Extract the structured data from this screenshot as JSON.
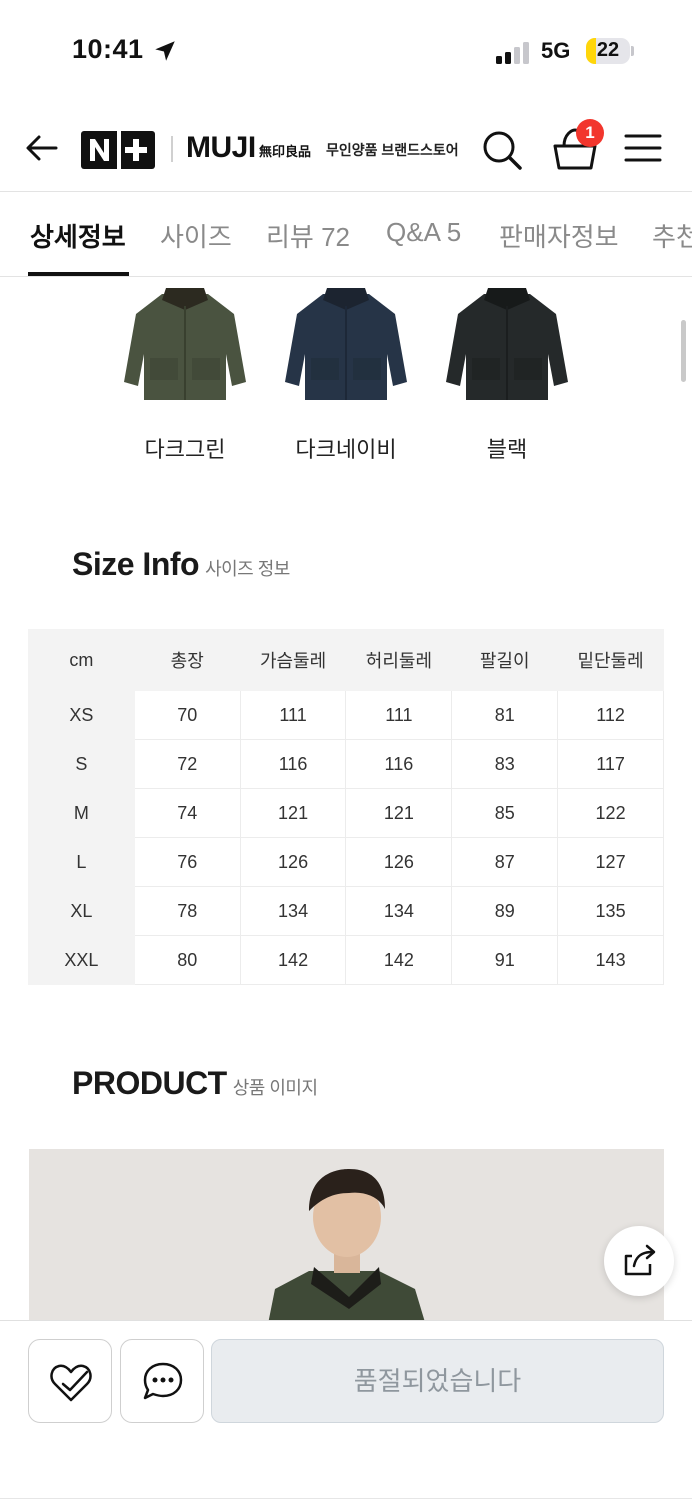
{
  "status_bar": {
    "time": "10:41",
    "network": "5G",
    "battery_level": "22",
    "battery_fraction": 0.22,
    "location_icon": "location-arrow-icon",
    "signal_icon": "cellular-signal-icon"
  },
  "header": {
    "logo_mark": "N+",
    "brand": "MUJI",
    "brand_kanji": "無印良品",
    "store_name": "무인양품 브랜드스토어",
    "cart_count": "1",
    "icons": [
      "back-arrow-icon",
      "search-icon",
      "shopping-bag-icon",
      "hamburger-menu-icon"
    ]
  },
  "tabs": [
    {
      "label": "상세정보",
      "active": true
    },
    {
      "label": "사이즈",
      "active": false
    },
    {
      "label": "리뷰 72",
      "active": false
    },
    {
      "label": "Q&A 5",
      "active": false
    },
    {
      "label": "판매자정보",
      "active": false
    },
    {
      "label": "추천",
      "active": false
    }
  ],
  "colors": [
    {
      "name": "다크그린",
      "swatch": "#4a5340"
    },
    {
      "name": "다크네이비",
      "swatch": "#263447"
    },
    {
      "name": "블랙",
      "swatch": "#25292a"
    }
  ],
  "size_info": {
    "title": "Size Info",
    "subtitle": "사이즈 정보",
    "headers": [
      "cm",
      "총장",
      "가슴둘레",
      "허리둘레",
      "팔길이",
      "밑단둘레"
    ],
    "rows": [
      [
        "XS",
        "70",
        "111",
        "111",
        "81",
        "112"
      ],
      [
        "S",
        "72",
        "116",
        "116",
        "83",
        "117"
      ],
      [
        "M",
        "74",
        "121",
        "121",
        "85",
        "122"
      ],
      [
        "L",
        "76",
        "126",
        "126",
        "87",
        "127"
      ],
      [
        "XL",
        "78",
        "134",
        "134",
        "89",
        "135"
      ],
      [
        "XXL",
        "80",
        "142",
        "142",
        "91",
        "143"
      ]
    ]
  },
  "product": {
    "title": "PRODUCT",
    "subtitle": "상품 이미지",
    "share_icon": "share-icon"
  },
  "bottom_bar": {
    "wish_icon": "heart-check-icon",
    "chat_icon": "chat-bubble-icon",
    "buy_label": "품절되었습니다"
  }
}
